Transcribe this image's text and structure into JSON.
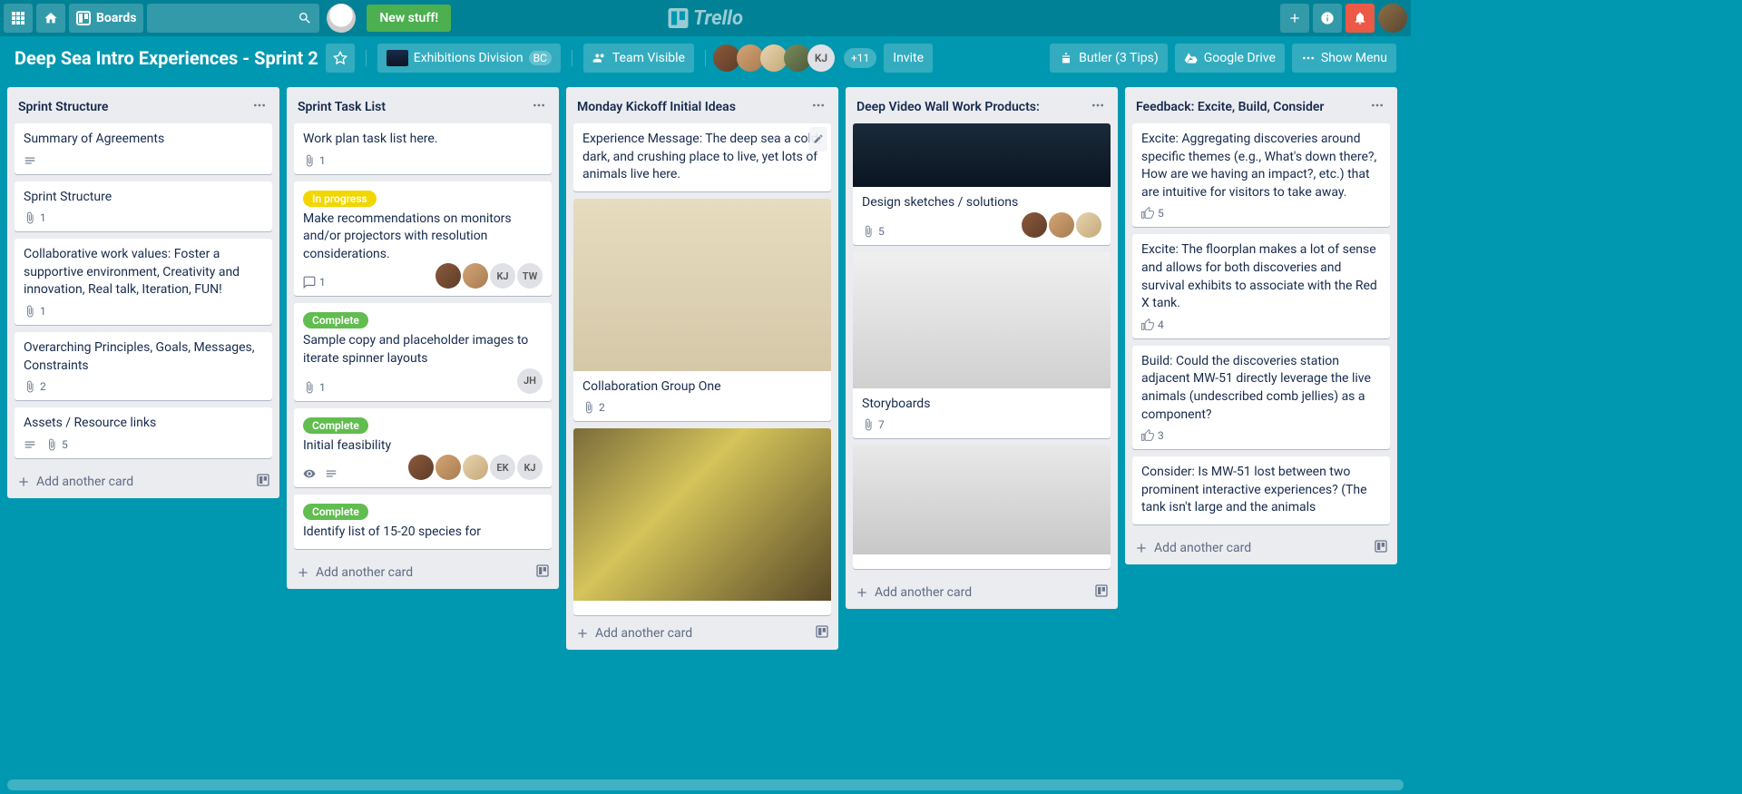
{
  "topbar": {
    "boards_label": "Boards",
    "new_stuff": "New stuff!",
    "logo": "Trello"
  },
  "boardbar": {
    "title": "Deep Sea Intro Experiences - Sprint 2",
    "org_label": "Exhibitions Division",
    "org_badge": "BC",
    "visibility": "Team Visible",
    "plus_count": "+11",
    "invite": "Invite",
    "butler": "Butler (3 Tips)",
    "gdrive": "Google Drive",
    "show_menu": "Show Menu"
  },
  "lists": [
    {
      "title": "Sprint Structure",
      "cards": [
        {
          "title": "Summary of Agreements",
          "badges": {
            "desc": true
          }
        },
        {
          "title": "Sprint Structure",
          "badges": {
            "attach": "1"
          }
        },
        {
          "title": "Collaborative work values: Foster a supportive environment, Creativity and innovation, Real talk, Iteration, FUN!",
          "badges": {
            "attach": "1"
          }
        },
        {
          "title": "Overarching Principles, Goals, Messages, Constraints",
          "badges": {
            "attach": "2"
          }
        },
        {
          "title": "Assets / Resource links",
          "badges": {
            "desc": true,
            "attach": "5"
          }
        }
      ],
      "add": "Add another card"
    },
    {
      "title": "Sprint Task List",
      "cards": [
        {
          "title": "Work plan task list here.",
          "badges": {
            "attach": "1"
          }
        },
        {
          "label": "In progress",
          "label_class": "lbl-yellow",
          "title": "Make recommendations on monitors and/or projectors with resolution considerations.",
          "badges": {
            "comments": "1"
          },
          "members": [
            "",
            "",
            "KJ",
            "TW"
          ]
        },
        {
          "label": "Complete",
          "label_class": "lbl-green",
          "title": "Sample copy and placeholder images to iterate spinner layouts",
          "badges": {
            "attach": "1"
          },
          "members": [
            "JH"
          ]
        },
        {
          "label": "Complete",
          "label_class": "lbl-green",
          "title": "Initial feasibility",
          "badges": {
            "watch": true,
            "desc": true
          },
          "members": [
            "",
            "",
            "",
            "EK",
            "KJ"
          ]
        },
        {
          "label": "Complete",
          "label_class": "lbl-green",
          "title": "Identify list of 15-20 species for"
        }
      ],
      "add": "Add another card"
    },
    {
      "title": "Monday Kickoff Initial Ideas",
      "cards": [
        {
          "title": "Experience Message: The deep sea a cold, dark, and crushing place to live, yet lots of animals live here.",
          "pen": true
        },
        {
          "cover": "cover1",
          "title": "Collaboration Group One",
          "badges": {
            "attach": "2"
          }
        },
        {
          "cover": "cover2",
          "title": ""
        }
      ],
      "add": "Add another card"
    },
    {
      "title": "Deep Video Wall Work Products:",
      "cards": [
        {
          "cover": "cover3",
          "title": "Design sketches / solutions",
          "badges": {
            "attach": "5"
          },
          "members": [
            "",
            "",
            ""
          ]
        },
        {
          "cover": "cover4",
          "title": "Storyboards",
          "badges": {
            "attach": "7"
          }
        },
        {
          "cover": "cover5",
          "title": ""
        }
      ],
      "add": "Add another card"
    },
    {
      "title": "Feedback: Excite, Build, Consider",
      "cards": [
        {
          "title": "Excite: Aggregating discoveries around specific themes (e.g., What's down there?, How are we having an impact?, etc.) that are intuitive for visitors to take away.",
          "badges": {
            "like": "5"
          }
        },
        {
          "title": "Excite: The floorplan makes a lot of sense and allows for both discoveries and survival exhibits to associate with the Red X tank.",
          "badges": {
            "like": "4"
          }
        },
        {
          "title": "Build: Could the discoveries station adjacent MW-51 directly leverage the live animals (undescribed comb jellies) as a component?",
          "badges": {
            "like": "3"
          }
        },
        {
          "title": "Consider: Is MW-51 lost between two prominent interactive experiences? (The tank isn't large and the animals"
        }
      ],
      "add": "Add another card"
    }
  ]
}
